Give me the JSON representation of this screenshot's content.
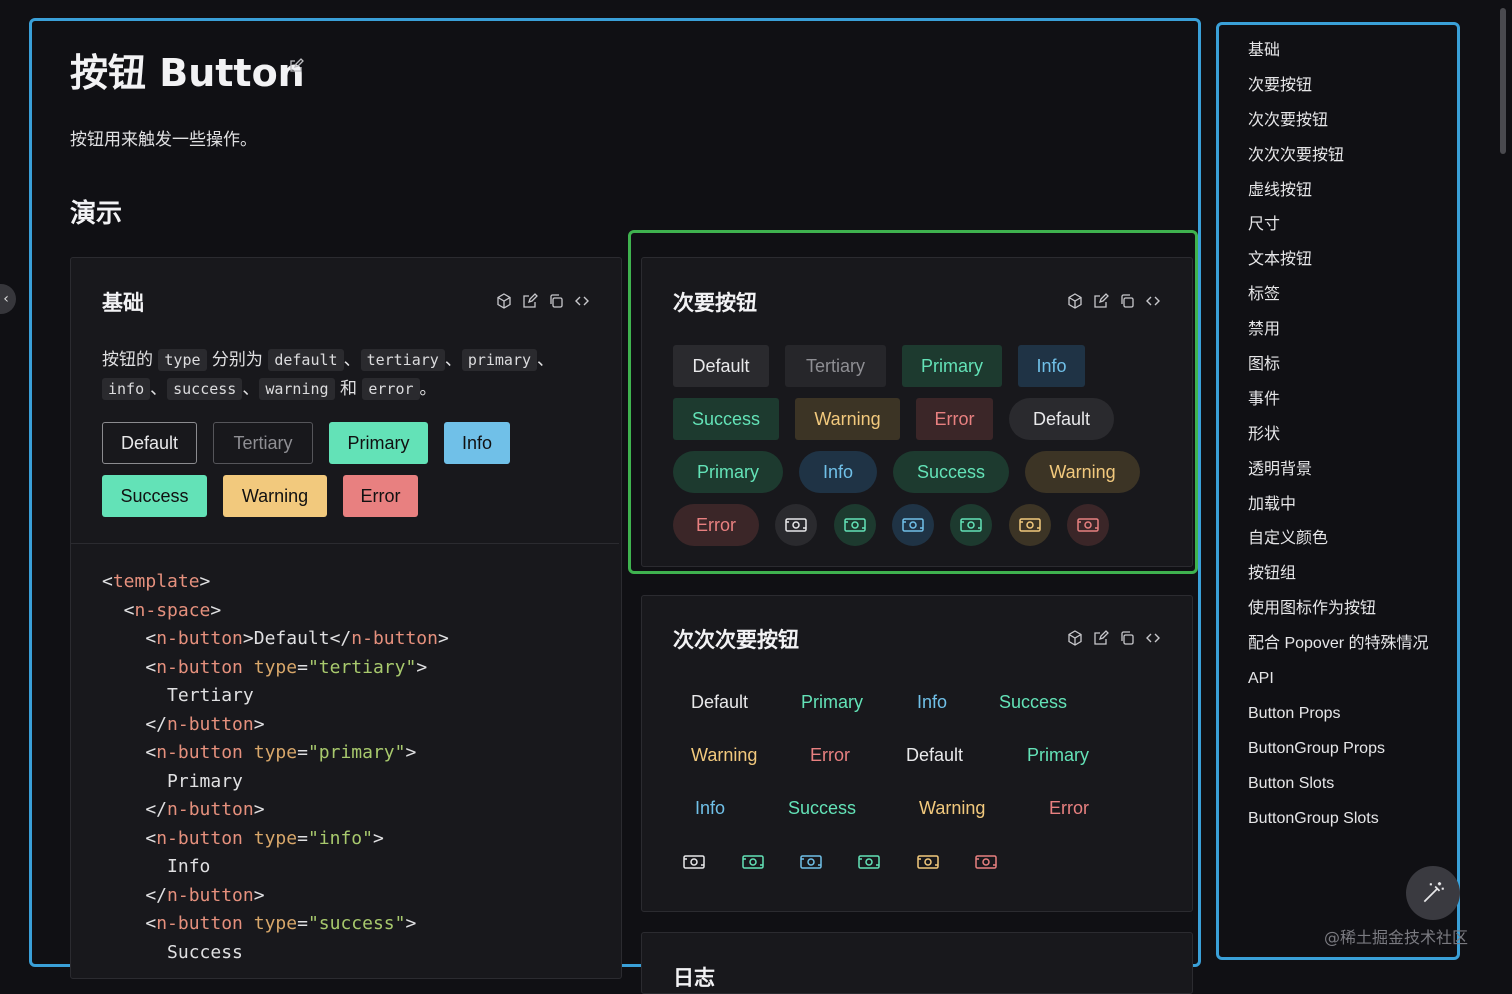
{
  "header": {
    "title": "按钮 Button",
    "description": "按钮用来触发一些操作。",
    "section": "演示"
  },
  "basic_card": {
    "title": "基础",
    "desc_parts": [
      "按钮的 ",
      "type",
      " 分别为 ",
      "default",
      "、",
      "tertiary",
      "、",
      "primary",
      "、",
      "info",
      "、",
      "success",
      "、",
      "warning",
      " 和 ",
      "error",
      "。"
    ],
    "buttons": [
      "Default",
      "Tertiary",
      "Primary",
      "Info",
      "Success",
      "Warning",
      "Error"
    ],
    "code_lines": [
      [
        [
          "<",
          "p"
        ],
        [
          "template",
          "tag"
        ],
        [
          ">",
          "p"
        ]
      ],
      [
        [
          "  <",
          "p"
        ],
        [
          "n-space",
          "tag"
        ],
        [
          ">",
          "p"
        ]
      ],
      [
        [
          "    <",
          "p"
        ],
        [
          "n-button",
          "tag"
        ],
        [
          ">Default</",
          "p"
        ],
        [
          "n-button",
          "tag"
        ],
        [
          ">",
          "p"
        ]
      ],
      [
        [
          "    <",
          "p"
        ],
        [
          "n-button",
          "tag"
        ],
        [
          " ",
          "p"
        ],
        [
          "type",
          "attr"
        ],
        [
          "=",
          "p"
        ],
        [
          "\"tertiary\"",
          "str"
        ],
        [
          ">",
          "p"
        ]
      ],
      [
        [
          "      Tertiary",
          "p"
        ]
      ],
      [
        [
          "    </",
          "p"
        ],
        [
          "n-button",
          "tag"
        ],
        [
          ">",
          "p"
        ]
      ],
      [
        [
          "    <",
          "p"
        ],
        [
          "n-button",
          "tag"
        ],
        [
          " ",
          "p"
        ],
        [
          "type",
          "attr"
        ],
        [
          "=",
          "p"
        ],
        [
          "\"primary\"",
          "str"
        ],
        [
          ">",
          "p"
        ]
      ],
      [
        [
          "      Primary",
          "p"
        ]
      ],
      [
        [
          "    </",
          "p"
        ],
        [
          "n-button",
          "tag"
        ],
        [
          ">",
          "p"
        ]
      ],
      [
        [
          "    <",
          "p"
        ],
        [
          "n-button",
          "tag"
        ],
        [
          " ",
          "p"
        ],
        [
          "type",
          "attr"
        ],
        [
          "=",
          "p"
        ],
        [
          "\"info\"",
          "str"
        ],
        [
          ">",
          "p"
        ]
      ],
      [
        [
          "      Info",
          "p"
        ]
      ],
      [
        [
          "    </",
          "p"
        ],
        [
          "n-button",
          "tag"
        ],
        [
          ">",
          "p"
        ]
      ],
      [
        [
          "    <",
          "p"
        ],
        [
          "n-button",
          "tag"
        ],
        [
          " ",
          "p"
        ],
        [
          "type",
          "attr"
        ],
        [
          "=",
          "p"
        ],
        [
          "\"success\"",
          "str"
        ],
        [
          ">",
          "p"
        ]
      ],
      [
        [
          "      Success",
          "p"
        ]
      ]
    ]
  },
  "secondary_card": {
    "title": "次要按钮",
    "row1": [
      "Default",
      "Tertiary",
      "Primary",
      "Info"
    ],
    "row2": [
      "Success",
      "Warning",
      "Error",
      "Default"
    ],
    "row3": [
      "Primary",
      "Info",
      "Success",
      "Warning"
    ],
    "row4_text": "Error"
  },
  "tertiary_card": {
    "title": "次次次要按钮",
    "row1": [
      "Default",
      "Primary",
      "Info",
      "Success"
    ],
    "row2": [
      "Warning",
      "Error",
      "Default",
      "Primary"
    ],
    "row3": [
      "Info",
      "Success",
      "Warning",
      "Error"
    ]
  },
  "next_card_title": "日志",
  "toc": {
    "items": [
      "基础",
      "次要按钮",
      "次次要按钮",
      "次次次要按钮",
      "虚线按钮",
      "尺寸",
      "文本按钮",
      "标签",
      "禁用",
      "图标",
      "事件",
      "形状",
      "透明背景",
      "加载中",
      "自定义颜色",
      "按钮组",
      "使用图标作为按钮",
      "配合 Popover 的特殊情况",
      "API",
      "Button Props",
      "ButtonGroup Props",
      "Button Slots",
      "ButtonGroup Slots"
    ]
  },
  "colors": {
    "default": "#e8e8ea",
    "tertiary": "#8e8e93",
    "primary": "#63e2b7",
    "info": "#70c0e8",
    "success": "#63e2b7",
    "warning": "#f2c97d",
    "error": "#e88080"
  },
  "watermark": "@稀土掘金技术社区"
}
